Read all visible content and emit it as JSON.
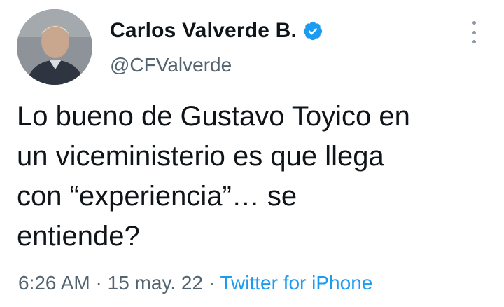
{
  "author": {
    "display_name": "Carlos Valverde B.",
    "handle": "@CFValverde",
    "verified": true,
    "verified_badge_icon": "verified-check-icon",
    "avatar_icon": "profile-photo"
  },
  "tweet": {
    "text": "Lo bueno de Gustavo Toyico en\nun viceministerio es que llega\ncon “experiencia”… se\nentiende?"
  },
  "meta": {
    "time": "6:26 AM",
    "separator": " · ",
    "date": "15 may. 22",
    "source": "Twitter for iPhone"
  },
  "menu": {
    "icon": "more-vertical-icon"
  },
  "colors": {
    "text_primary": "#0f1419",
    "text_secondary": "#536471",
    "accent": "#1d9bf0"
  }
}
